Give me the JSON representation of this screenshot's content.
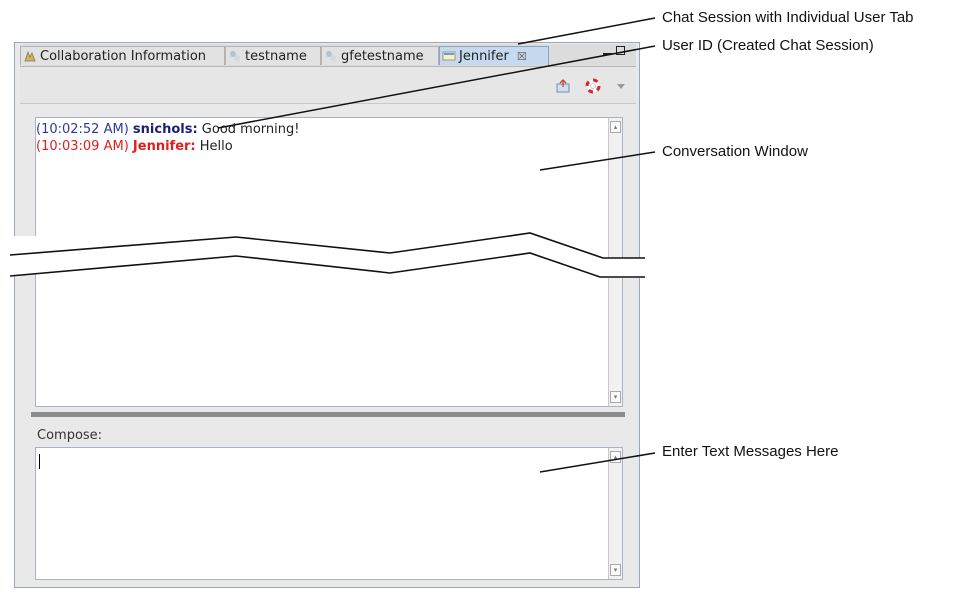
{
  "tabs": [
    {
      "label": "Collaboration Information",
      "icon": "collaboration-icon",
      "active": false
    },
    {
      "label": "testname",
      "icon": "user-chat-icon",
      "active": false
    },
    {
      "label": "gfetestname",
      "icon": "user-chat-icon",
      "active": false
    },
    {
      "label": "Jennifer",
      "icon": "chat-session-icon",
      "active": true,
      "close": "☒"
    }
  ],
  "toolbar": {
    "icons": [
      "send-file-icon",
      "help-lifesaver-icon",
      "view-menu-icon"
    ]
  },
  "conversation": {
    "messages": [
      {
        "time": "(10:02:52 AM)",
        "user": "snichols:",
        "text": "Good morning!",
        "color": "#2c3a9e"
      },
      {
        "time": "(10:03:09 AM)",
        "user": "Jennifer:",
        "text": "Hello",
        "color": "#e11d1d"
      }
    ]
  },
  "compose": {
    "label": "Compose:",
    "value": ""
  },
  "callouts": {
    "chat_tab": "Chat Session with Individual User Tab",
    "user_id": "User ID (Created Chat Session)",
    "conversation_window": "Conversation Window",
    "enter_text": "Enter Text Messages Here"
  },
  "colors": {
    "tab_active": "#c7d9ef",
    "panel_border": "#9aa7b8",
    "blue_user": "#2c3a9e",
    "red_user": "#e11d1d"
  }
}
